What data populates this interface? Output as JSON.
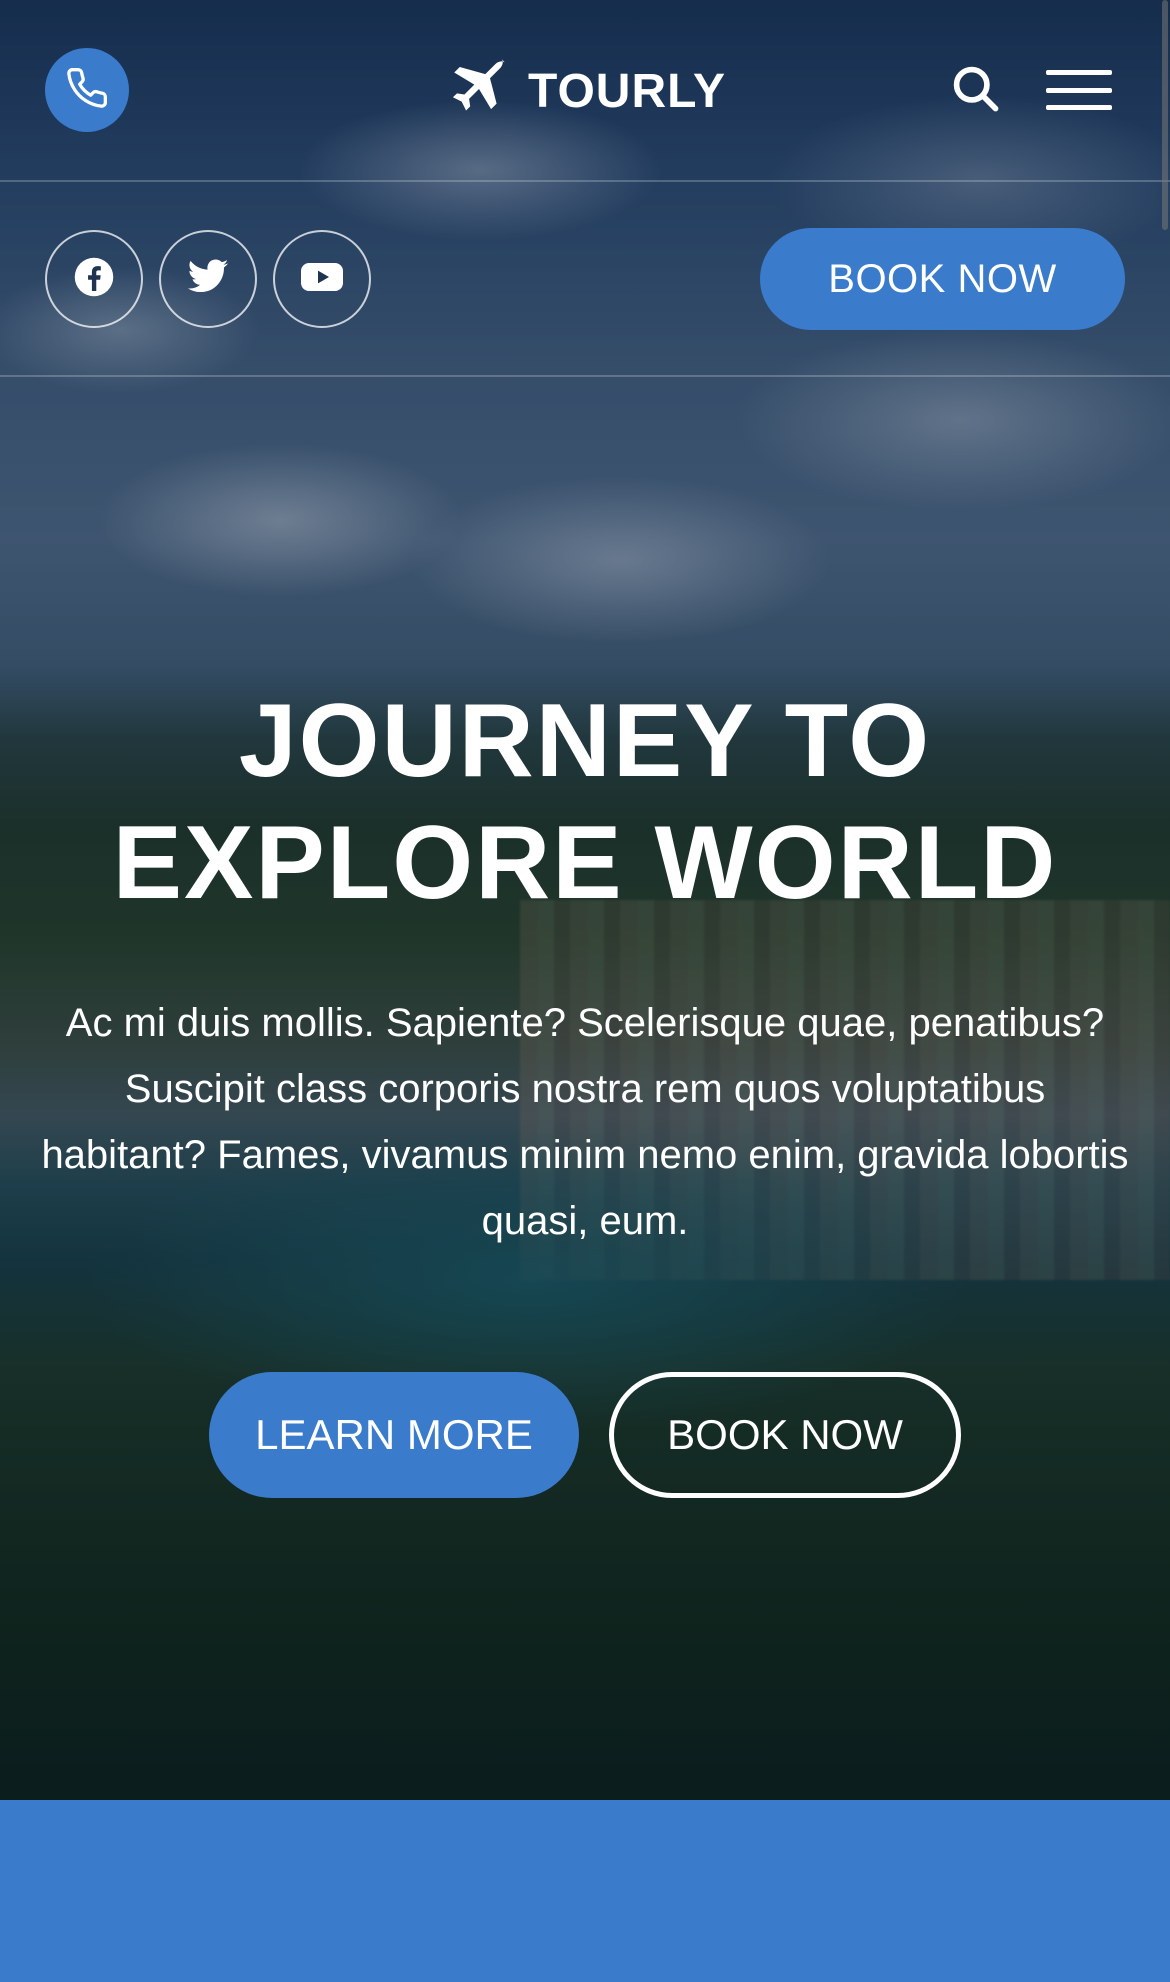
{
  "brand": {
    "name": "TOURLY"
  },
  "header": {
    "phone_icon": "phone-icon",
    "logo_icon": "airplane-icon",
    "search_icon": "search-icon",
    "menu_icon": "hamburger-menu-icon",
    "book_label": "BOOK NOW"
  },
  "social": [
    {
      "icon": "facebook-icon"
    },
    {
      "icon": "twitter-icon"
    },
    {
      "icon": "youtube-icon"
    }
  ],
  "hero": {
    "headline_line1": "JOURNEY TO",
    "headline_line2": "EXPLORE WORLD",
    "paragraph": "Ac mi duis mollis. Sapiente? Scelerisque quae, penatibus? Suscipit class corporis nostra rem quos voluptatibus habitant? Fames, vivamus minim nemo enim, gravida lobortis quasi, eum.",
    "learn_more_label": "LEARN MORE",
    "book_now_label": "BOOK NOW"
  },
  "colors": {
    "accent": "#3a7bcc",
    "text": "#ffffff"
  }
}
